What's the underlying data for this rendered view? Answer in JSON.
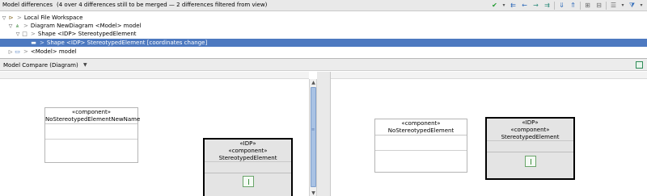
{
  "header": {
    "diff_label": "Model differences",
    "summary": "(4 over 4 differences still to be merged — 2 differences filtered from view)"
  },
  "toolbar": {
    "icons": [
      "accept-check-icon",
      "dropdown-arrow-icon",
      "copy-all-left-icon",
      "copy-left-icon",
      "copy-right-icon",
      "copy-all-right-icon",
      "next-diff-icon",
      "prev-diff-icon",
      "expand-all-icon",
      "collapse-all-icon",
      "group-icon",
      "filter-icon"
    ]
  },
  "tree": {
    "rows": [
      {
        "label": "Local File Workspace",
        "icon": "workspace-icon"
      },
      {
        "label": "Diagram NewDiagram <Model> model",
        "icon": "diagram-icon"
      },
      {
        "label": "Shape <IDP> StereotypedElement",
        "icon": "shape-icon"
      },
      {
        "label": "Shape <IDP> StereotypedElement [coordinates change]",
        "icon": "shape-diff-icon"
      },
      {
        "label": "<Model> model",
        "icon": "model-folder-icon"
      }
    ],
    "chevron": ">"
  },
  "compare": {
    "label": "Model Compare (Diagram)"
  },
  "left_canvas": {
    "component_box": {
      "stereotype": "«component»",
      "name": "NoStereotypedElementNewName"
    },
    "idp_box": {
      "stereotype1": "«IDP»",
      "stereotype2": "«component»",
      "name": "StereotypedElement"
    }
  },
  "right_canvas": {
    "component_box": {
      "stereotype": "«component»",
      "name": "NoStereotypedElement"
    },
    "idp_box": {
      "stereotype1": "«IDP»",
      "stereotype2": "«component»",
      "name": "StereotypedElement"
    }
  },
  "colors": {
    "selection": "#4d79c0",
    "accept_green": "#1f9b2e",
    "scroll_thumb": "#a9c2e4"
  }
}
